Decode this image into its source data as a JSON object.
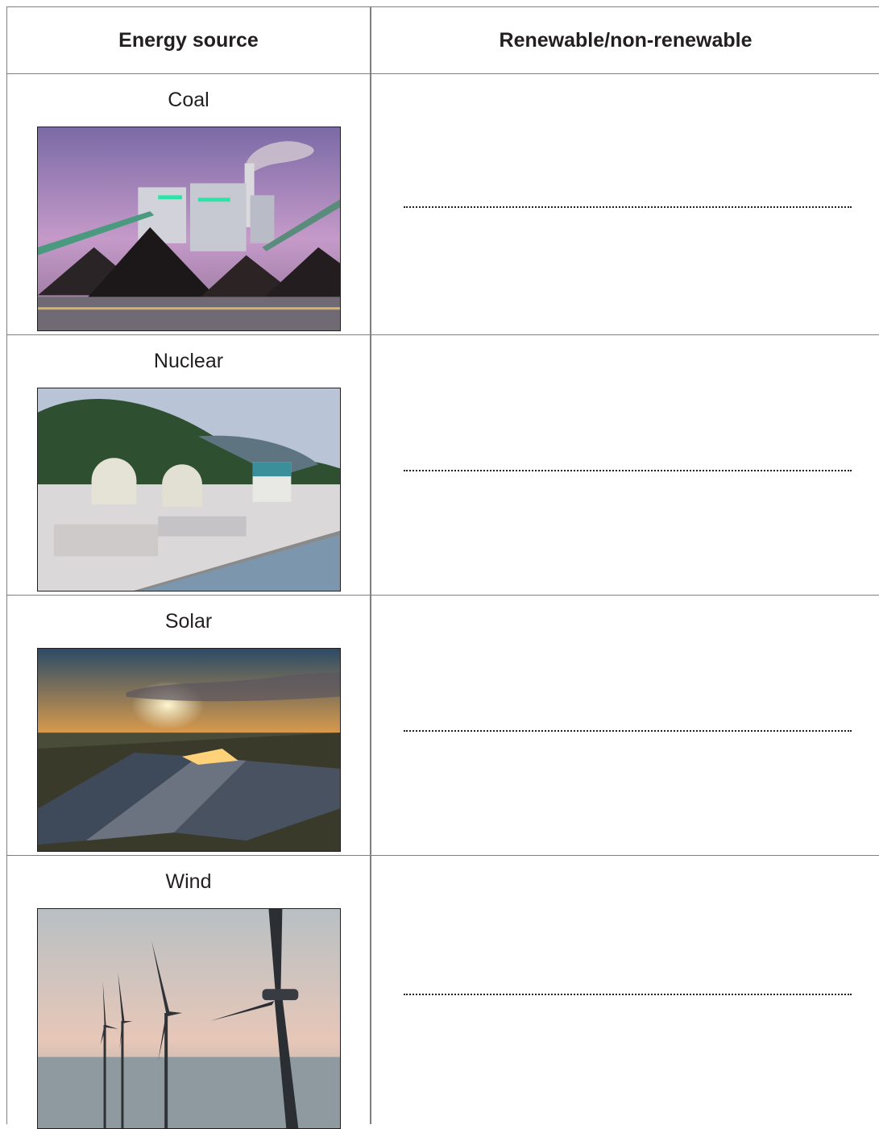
{
  "table": {
    "headers": {
      "source": "Energy source",
      "type": "Renewable/non-renewable"
    },
    "rows": [
      {
        "source": "Coal",
        "photo_icon": "coal-power-plant-photo"
      },
      {
        "source": "Nuclear",
        "photo_icon": "nuclear-power-plant-photo"
      },
      {
        "source": "Solar",
        "photo_icon": "solar-farm-photo"
      },
      {
        "source": "Wind",
        "photo_icon": "offshore-wind-turbines-photo"
      }
    ]
  }
}
